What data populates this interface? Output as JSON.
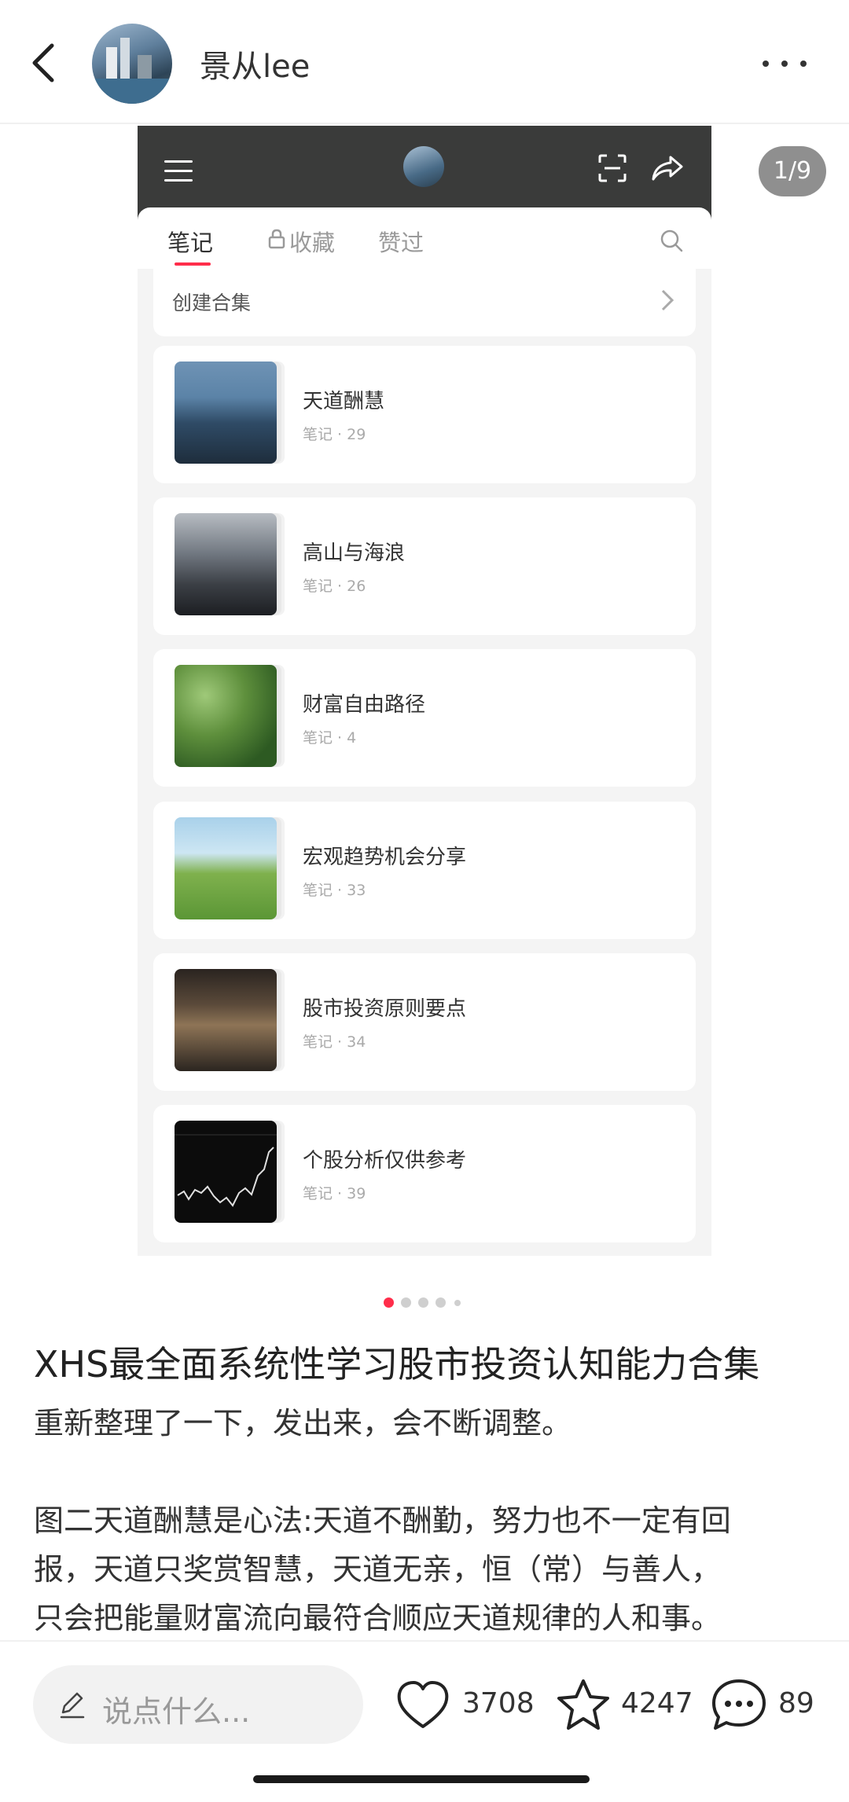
{
  "header": {
    "username": "景从lee",
    "icons": [
      "chevron-left-icon",
      "more-icon"
    ]
  },
  "image_viewer": {
    "page_indicator": "1/9",
    "dots_count": 5,
    "active_dot": 0,
    "screenshot": {
      "tabs": [
        "笔记",
        "收藏",
        "赞过"
      ],
      "active_tab": "笔记",
      "create_label": "创建合集",
      "collections": [
        {
          "title": "天道酬慧",
          "sub": "笔记 · 29"
        },
        {
          "title": "高山与海浪",
          "sub": "笔记 · 26"
        },
        {
          "title": "财富自由路径",
          "sub": "笔记 · 4"
        },
        {
          "title": "宏观趋势机会分享",
          "sub": "笔记 · 33"
        },
        {
          "title": "股市投资原则要点",
          "sub": "笔记 · 34"
        },
        {
          "title": "个股分析仅供参考",
          "sub": "笔记 · 39"
        }
      ]
    }
  },
  "post": {
    "title": "XHS最全面系统性学习股市投资认知能力合集",
    "line1": "重新整理了一下，发出来，会不断调整。",
    "para2_l1": "图二天道酬慧是心法:天道不酬勤，努力也不一定有回",
    "para2_l2": "报，天道只奖赏智慧，天道无亲，恒（常）与善人，",
    "para2_l3": "只会把能量财富流向最符合顺应天道规律的人和事。"
  },
  "bottom_bar": {
    "comment_placeholder": "说点什么...",
    "likes": "3708",
    "collects": "4247",
    "comments": "89"
  },
  "colors": {
    "accent": "#ff2d4a",
    "badge_bg": "#8f8f8f"
  }
}
